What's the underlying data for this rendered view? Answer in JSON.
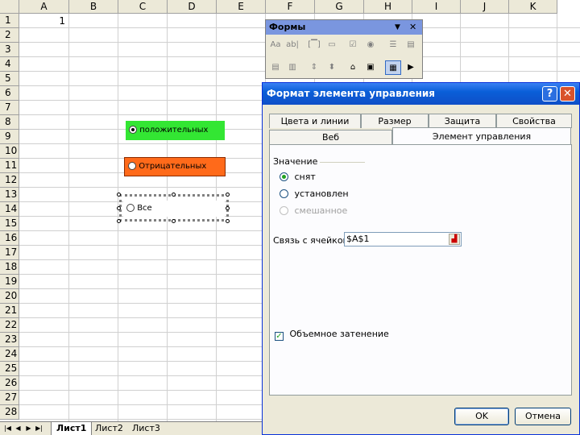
{
  "spreadsheet": {
    "columns": [
      "A",
      "B",
      "C",
      "D",
      "E",
      "F",
      "G",
      "H",
      "I",
      "J",
      "K"
    ],
    "rows": [
      "1",
      "2",
      "3",
      "4",
      "5",
      "6",
      "7",
      "8",
      "9",
      "10",
      "11",
      "12",
      "13",
      "14",
      "15",
      "16",
      "17",
      "18",
      "19",
      "20",
      "21",
      "22",
      "23",
      "24",
      "25",
      "26",
      "27",
      "28"
    ],
    "cell_a1": "1",
    "sheet_tabs": [
      "Лист1",
      "Лист2",
      "Лист3"
    ],
    "active_tab": "Лист1"
  },
  "form_controls": {
    "positive": {
      "label": "положительных",
      "color": "#33e633",
      "checked": true
    },
    "negative": {
      "label": "Отрицательных",
      "color": "#ff6a1a",
      "checked": false
    },
    "all": {
      "label": "Все",
      "checked": false
    }
  },
  "forms_toolbar": {
    "title": "Формы",
    "dropdown_glyph": "▼",
    "close_glyph": "✕"
  },
  "dialog": {
    "title": "Формат элемента управления",
    "help_glyph": "?",
    "close_glyph": "✕",
    "tabs_row1": [
      "Цвета и линии",
      "Размер",
      "Защита",
      "Свойства"
    ],
    "tabs_row2": [
      "Веб",
      "Элемент управления"
    ],
    "active_tab": "Элемент управления",
    "value_group": "Значение",
    "radio_unchecked_label": "снят",
    "radio_checked_label": "установлен",
    "radio_mixed_label": "смешанное",
    "link_label": "Связь с ячейкой:",
    "link_value": "$A$1",
    "shading_label": "Объемное затенение",
    "ok": "OK",
    "cancel": "Отмена"
  }
}
